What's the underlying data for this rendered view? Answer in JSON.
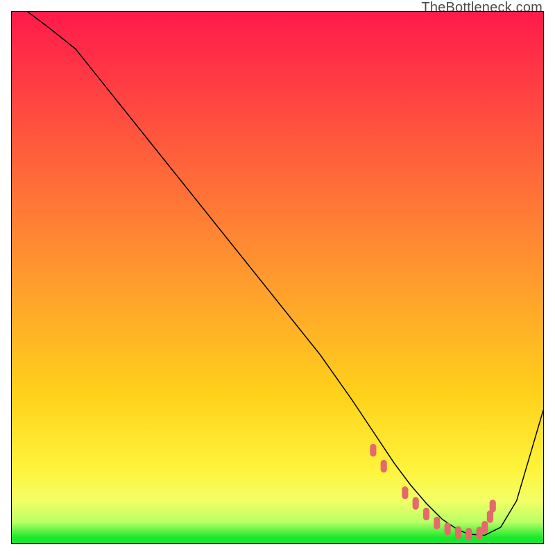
{
  "watermark": "TheBottleneck.com",
  "gradient_colors": {
    "c0": "#ff1a4b",
    "c1": "#ff5a3c",
    "c2": "#ff9a2e",
    "c3": "#ffd11a",
    "c4": "#fff33b",
    "c5": "#f3ff66",
    "c6": "#baff66",
    "c7": "#17e82a"
  },
  "chart_data": {
    "type": "line",
    "title": "",
    "xlabel": "",
    "ylabel": "",
    "xlim": [
      0,
      100
    ],
    "ylim": [
      0,
      100
    ],
    "grid": false,
    "legend": false,
    "series": [
      {
        "name": "bottleneck-curve",
        "stroke": "#000000",
        "stroke_width": 1.5,
        "x": [
          3,
          7,
          12,
          20,
          30,
          40,
          50,
          58,
          64,
          68,
          72,
          75,
          78,
          81,
          84,
          86,
          89,
          92,
          95,
          100
        ],
        "y": [
          100,
          97,
          93,
          83,
          70.5,
          58,
          45.5,
          35.5,
          27,
          21,
          15,
          11,
          7.5,
          4.5,
          2.5,
          1.7,
          1.5,
          3,
          8,
          25
        ]
      },
      {
        "name": "trough-dots",
        "type": "scatter",
        "stroke": "#e36a6a",
        "fill": "#e36a6a",
        "marker_w": 1.2,
        "marker_h": 2.4,
        "x": [
          68,
          70,
          74,
          76,
          78,
          80,
          82,
          84,
          86,
          88,
          89,
          90,
          90.5
        ],
        "y": [
          17.5,
          14.5,
          9.5,
          7.5,
          5.5,
          3.8,
          2.7,
          2.0,
          1.7,
          1.9,
          3.0,
          5.0,
          7.0
        ]
      }
    ]
  }
}
